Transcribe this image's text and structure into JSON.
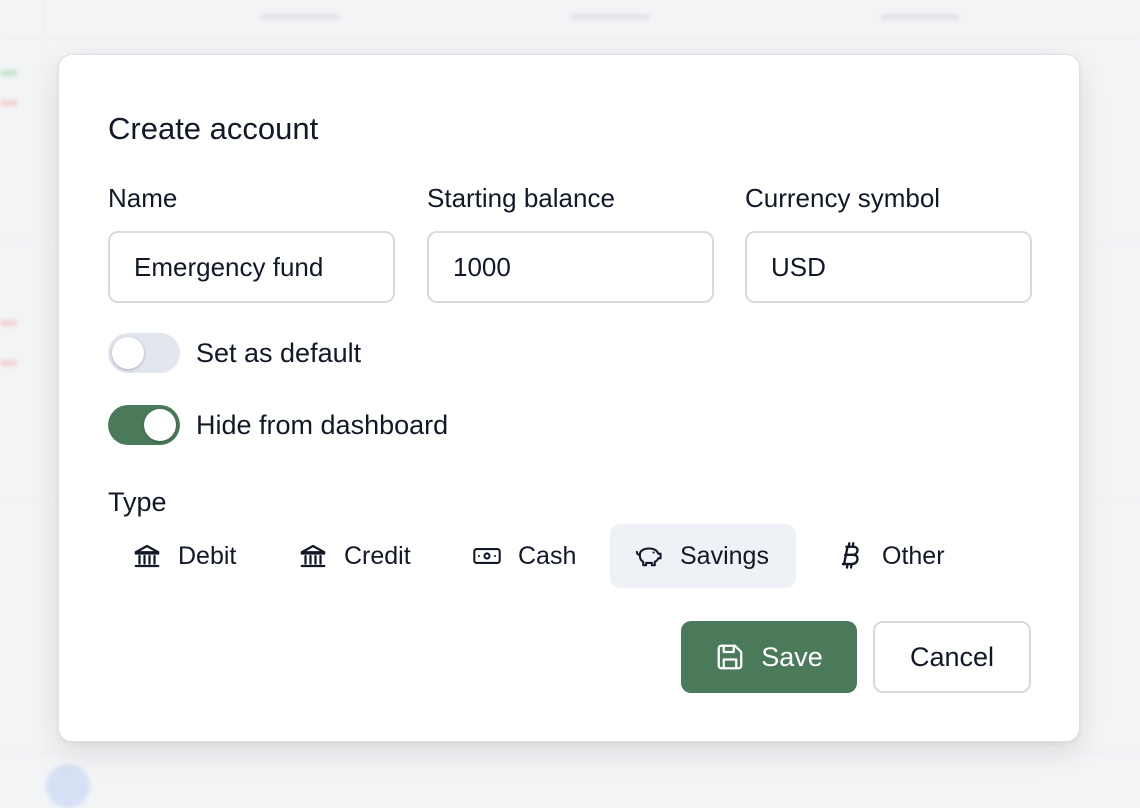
{
  "dialog": {
    "title": "Create account",
    "fields": {
      "name": {
        "label": "Name",
        "value": "Emergency fund"
      },
      "starting_balance": {
        "label": "Starting balance",
        "value": "1000"
      },
      "currency_symbol": {
        "label": "Currency symbol",
        "value": "USD"
      }
    },
    "toggles": [
      {
        "label": "Set as default",
        "checked": false
      },
      {
        "label": "Hide from dashboard",
        "checked": true
      }
    ],
    "type": {
      "label": "Type",
      "selected": "Savings",
      "options": [
        {
          "label": "Debit",
          "icon": "bank-icon"
        },
        {
          "label": "Credit",
          "icon": "bank-icon"
        },
        {
          "label": "Cash",
          "icon": "cash-icon"
        },
        {
          "label": "Savings",
          "icon": "piggy-bank-icon"
        },
        {
          "label": "Other",
          "icon": "bitcoin-icon"
        }
      ]
    },
    "actions": {
      "save_label": "Save",
      "save_icon": "save-icon",
      "cancel_label": "Cancel"
    }
  },
  "colors": {
    "accent": "#4a7a5a",
    "selected_bg": "#eef1f6",
    "border": "#d7dbe0",
    "toggle_off": "#e2e6ee"
  }
}
